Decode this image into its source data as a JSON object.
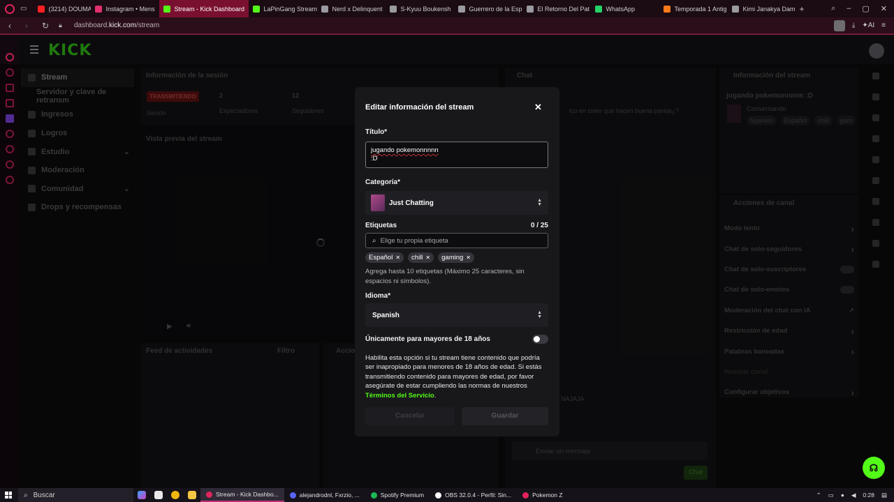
{
  "browser": {
    "tabs": [
      {
        "label": "(3214) DOUMA VS",
        "icon": "youtube-icon",
        "color": "#ff2020"
      },
      {
        "label": "Instagram • Mens",
        "icon": "instagram-icon",
        "color": "#e1306c"
      },
      {
        "label": "Stream - Kick Dashboard",
        "icon": "kick-icon",
        "color": "#53fc18",
        "active": true
      },
      {
        "label": "LaPinGang Stream",
        "icon": "kick-icon",
        "color": "#53fc18"
      },
      {
        "label": "Nerd x Delinquent",
        "icon": "mw-icon",
        "color": "#9a9aa0"
      },
      {
        "label": "S-Kyuu Boukensh",
        "icon": "mw-icon",
        "color": "#9a9aa0"
      },
      {
        "label": "Guerrero de la Esp",
        "icon": "mw-icon",
        "color": "#9a9aa0"
      },
      {
        "label": "El Retorno Del Pat",
        "icon": "mw-icon",
        "color": "#9a9aa0"
      },
      {
        "label": "WhatsApp",
        "icon": "whatsapp-icon",
        "color": "#25d366"
      },
      {
        "label": "Temporada 1 Antig",
        "icon": "firefox-icon",
        "color": "#ff7a1a"
      },
      {
        "label": "Kimi Janakya Dam",
        "icon": "mw-icon",
        "color": "#9a9aa0"
      }
    ],
    "new_tab": "+",
    "url_prefix": "dashboard.",
    "url_domain": "kick.com",
    "url_path": "/stream",
    "ai_label": "AI"
  },
  "header": {
    "logo": "KICK"
  },
  "nav": {
    "items": [
      {
        "label": "Stream",
        "active": true
      },
      {
        "label": "Servidor y clave de retransm",
        "sub": true
      },
      {
        "label": "Ingresos"
      },
      {
        "label": "Logros"
      },
      {
        "label": "Estudio",
        "chevron": true
      },
      {
        "label": "Moderación"
      },
      {
        "label": "Comunidad",
        "chevron": true
      },
      {
        "label": "Drops y recompensas"
      }
    ]
  },
  "panels": {
    "session_title": "Información de la sesión",
    "live_badge": "TRANSMITIENDO",
    "session_label": "Sesión",
    "viewers_value": "2",
    "viewers_label": "Espectadores",
    "followers_value": "12",
    "followers_label": "Seguidores",
    "preview_title": "Vista previa del stream",
    "activity_title": "Feed de actividades",
    "activity_filter": "Filtro",
    "actions_short": "Accio",
    "chat_title": "Chat",
    "chat_line1": "ico en creer que hacen buena pareja¿?",
    "chat_line2": "NAJAJA",
    "chat_placeholder": "Enviar un mensaje",
    "chat_button": "Chat",
    "stream_info_title": "Información del stream",
    "stream_info_name": "jugando pokemonnnnn :D",
    "stream_info_category": "Conversando",
    "stream_info_tags": [
      "Spanish",
      "Español",
      "chill",
      "gam"
    ],
    "channel_actions_title": "Acciones de canal",
    "channel_actions": [
      {
        "label": "Modo lento",
        "control": "chevron"
      },
      {
        "label": "Chat de solo-seguidores",
        "control": "chevron"
      },
      {
        "label": "Chat de solo-suscriptores",
        "control": "toggle"
      },
      {
        "label": "Chat de solo-emotes",
        "control": "toggle"
      },
      {
        "label": "Moderación del chat con IA",
        "control": "link"
      },
      {
        "label": "Restricción de edad",
        "control": "chevron"
      },
      {
        "label": "Palabras baneadas",
        "control": "chevron"
      },
      {
        "label": "Hostear canal",
        "control": "none"
      },
      {
        "label": "Configurar objetivos",
        "control": "chevron"
      }
    ]
  },
  "modal": {
    "title": "Editar información del stream",
    "title_label": "Título*",
    "title_value_line1": "jugando pokemonnnnn",
    "title_value_line2": ":D",
    "category_label": "Categoría*",
    "category_value": "Just Chatting",
    "tags_label": "Etiquetas",
    "tags_counter": "0 / 25",
    "tags_placeholder": "Elige tu propia etiqueta",
    "tags": [
      "Español",
      "chill",
      "gaming"
    ],
    "tags_help": "Agrega hasta 10 etiquetas (Máximo 25 caracteres, sin espacios ni símbolos).",
    "language_label": "Idioma*",
    "language_value": "Spanish",
    "adult_label": "Únicamente para mayores de 18 años",
    "adult_toggle_on": false,
    "adult_desc": "Habilita esta opción si tu stream tiene contenido que podría ser inapropiado para menores de 18 años de edad. Si estás transmitiendo contenido para mayores de edad, por favor asegúrate de estar cumpliendo las normas de nuestros ",
    "adult_desc_link": "Términos del Servicio",
    "adult_desc_end": ".",
    "cancel": "Cancelar",
    "save": "Guardar"
  },
  "taskbar": {
    "search": "Buscar",
    "tasks": [
      {
        "label": "Stream - Kick Dashbo...",
        "color": "#e0245e",
        "active": true
      },
      {
        "label": "alejandrodnl, Fxrzio, ...",
        "color": "#5865f2"
      },
      {
        "label": "Spotify Premium",
        "color": "#1db954"
      },
      {
        "label": "OBS 32.0.4 - Perfil: Sin...",
        "color": "#ffffff"
      },
      {
        "label": "Pokemon Z",
        "color": "#e0245e"
      }
    ],
    "time": "0:28"
  },
  "colors": {
    "kick_green": "#53fc18",
    "opera_red": "#e0245e"
  }
}
